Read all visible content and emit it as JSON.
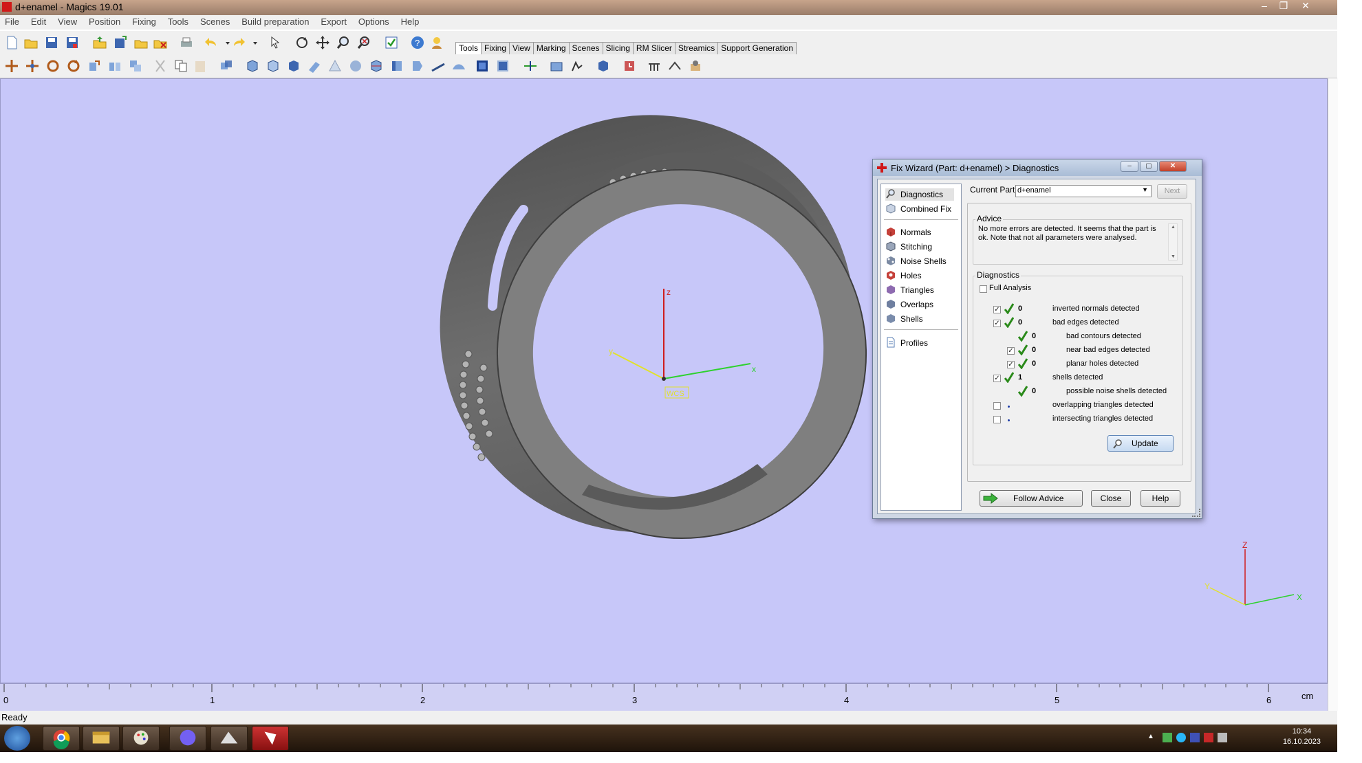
{
  "window": {
    "title": "d+enamel - Magics 19.01"
  },
  "menu": [
    "File",
    "Edit",
    "View",
    "Position",
    "Fixing",
    "Tools",
    "Scenes",
    "Build preparation",
    "Export",
    "Options",
    "Help"
  ],
  "ribbon_tabs": [
    "Tools",
    "Fixing",
    "View",
    "Marking",
    "Scenes",
    "Slicing",
    "RM Slicer",
    "Streamics",
    "Support Generation"
  ],
  "viewport": {
    "background": "#c7c7f9",
    "axes": {
      "x": "x",
      "y": "y",
      "z": "z",
      "wcs": "WCS"
    },
    "corner_axes": {
      "x": "X",
      "y": "Y",
      "z": "Z"
    }
  },
  "ruler": {
    "ticks": [
      "0",
      "1",
      "2",
      "3",
      "4",
      "5",
      "6"
    ],
    "unit": "cm"
  },
  "status": "Ready",
  "taskbar": {
    "time": "10:34",
    "date": "16.10.2023"
  },
  "dialog": {
    "title": "Fix Wizard (Part: d+enamel) > Diagnostics",
    "nav": {
      "top": [
        "Diagnostics",
        "Combined Fix"
      ],
      "tools": [
        "Normals",
        "Stitching",
        "Noise Shells",
        "Holes",
        "Triangles",
        "Overlaps",
        "Shells"
      ],
      "bottom": [
        "Profiles"
      ]
    },
    "current_part_label": "Current Part:",
    "current_part_value": "d+enamel",
    "next_label": "Next",
    "advice_title": "Advice",
    "advice_text": "No more errors are detected. It seems that the part is ok. Note that not all parameters were analysed.",
    "diagnostics_title": "Diagnostics",
    "full_analysis_label": "Full Analysis",
    "rows": [
      {
        "checked": true,
        "count": "0",
        "label": "inverted normals detected"
      },
      {
        "checked": true,
        "count": "0",
        "label": "bad edges detected"
      },
      {
        "checked": null,
        "count": "0",
        "label": "bad contours detected"
      },
      {
        "checked": true,
        "count": "0",
        "label": "near bad edges detected"
      },
      {
        "checked": true,
        "count": "0",
        "label": "planar holes detected"
      },
      {
        "checked": true,
        "count": "1",
        "label": "shells detected"
      },
      {
        "checked": null,
        "count": "0",
        "label": "possible noise shells detected"
      },
      {
        "checked": false,
        "count": "",
        "label": "overlapping triangles detected"
      },
      {
        "checked": false,
        "count": "",
        "label": "intersecting triangles detected"
      }
    ],
    "update_label": "Update",
    "follow_advice_label": "Follow Advice",
    "close_label": "Close",
    "help_label": "Help"
  }
}
